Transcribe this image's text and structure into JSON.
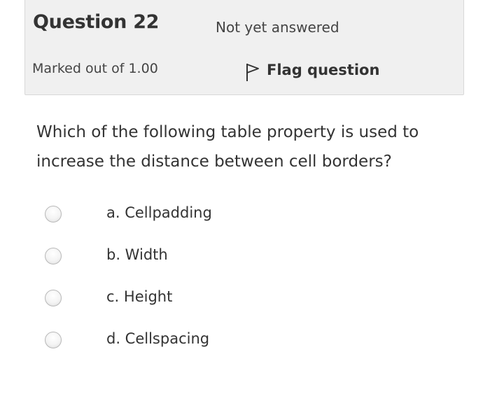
{
  "question": {
    "title": "Question 22",
    "state": "Not yet answered",
    "grade": "Marked out of 1.00",
    "flag_label": "Flag question",
    "text": "Which of the following table property is used to increase the distance between cell borders?"
  },
  "answers": [
    {
      "label": "a. Cellpadding"
    },
    {
      "label": "b. Width"
    },
    {
      "label": "c. Height"
    },
    {
      "label": "d. Cellspacing"
    }
  ],
  "icons": {
    "flag": "flag-icon"
  },
  "colors": {
    "info_background": "#f0f0f0",
    "text": "#333333"
  }
}
